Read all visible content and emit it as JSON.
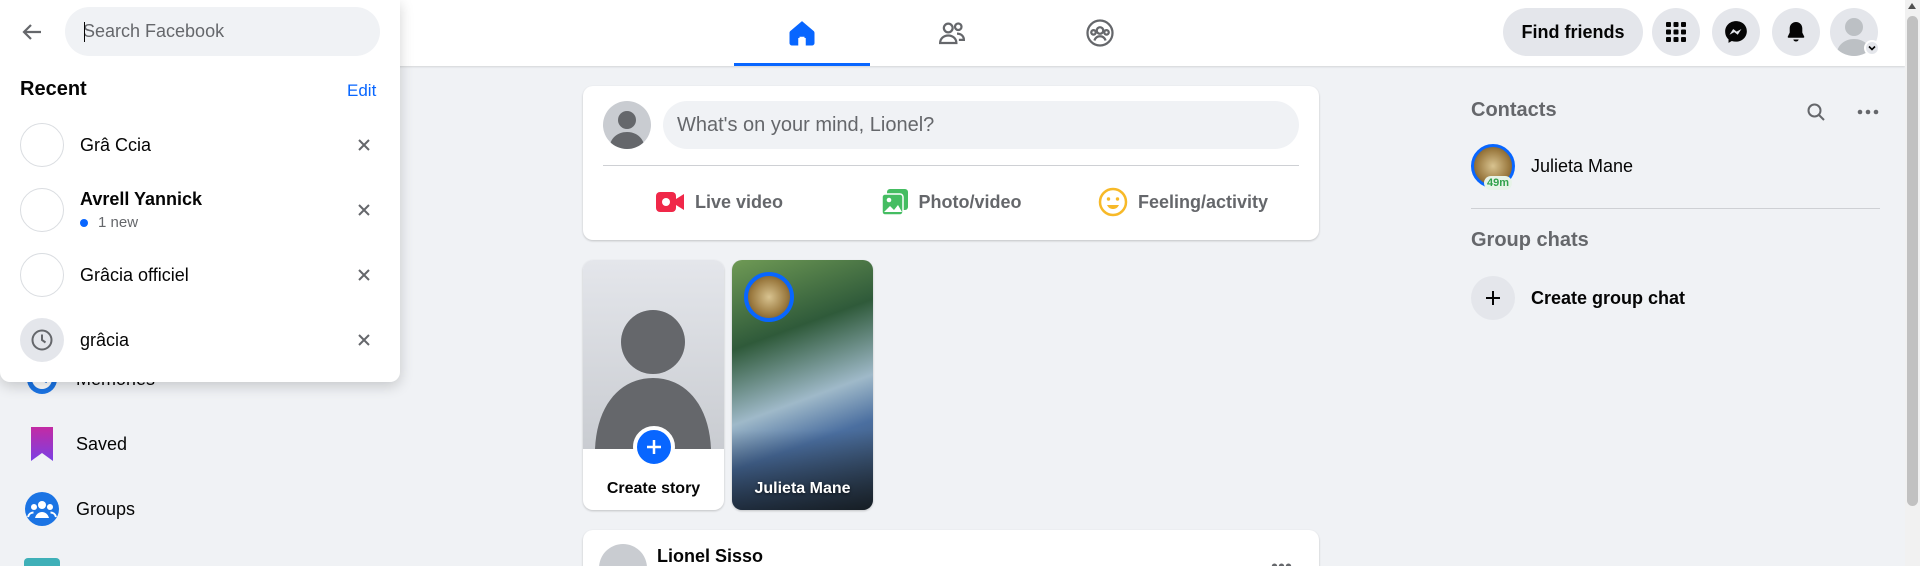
{
  "search": {
    "placeholder": "Search Facebook",
    "recent_title": "Recent",
    "edit_label": "Edit",
    "items": [
      {
        "name": "Grâ Ccia",
        "sub": "",
        "kind": "profile"
      },
      {
        "name": "Avrell Yannick",
        "sub": "1 new",
        "kind": "profile"
      },
      {
        "name": "Grâcia officiel",
        "sub": "",
        "kind": "profile"
      },
      {
        "name": "grâcia",
        "sub": "",
        "kind": "history"
      }
    ]
  },
  "header": {
    "tabs": [
      {
        "name": "home",
        "active": true,
        "icon": "home-icon"
      },
      {
        "name": "friends",
        "active": false,
        "icon": "friends-icon"
      },
      {
        "name": "groups",
        "active": false,
        "icon": "groups-icon"
      }
    ],
    "find_friends_label": "Find friends",
    "icons": [
      "menu-grid-icon",
      "messenger-icon",
      "notifications-icon",
      "account-icon"
    ]
  },
  "left_sidebar": {
    "items": [
      {
        "label": "Memories",
        "icon": "memories-icon"
      },
      {
        "label": "Saved",
        "icon": "saved-icon"
      },
      {
        "label": "Groups",
        "icon": "groups-icon"
      }
    ]
  },
  "composer": {
    "placeholder": "What's on your mind, Lionel?",
    "actions": [
      {
        "label": "Live video",
        "icon": "live-video-icon",
        "color": "#f02849"
      },
      {
        "label": "Photo/video",
        "icon": "photo-video-icon",
        "color": "#45bd62"
      },
      {
        "label": "Feeling/activity",
        "icon": "feeling-icon",
        "color": "#f7b928"
      }
    ]
  },
  "stories": {
    "create_label": "Create story",
    "items": [
      {
        "name": "Julieta Mane"
      }
    ]
  },
  "post": {
    "author": "Lionel Sisso"
  },
  "right_sidebar": {
    "contacts_title": "Contacts",
    "contacts": [
      {
        "name": "Julieta Mane",
        "badge": "49m"
      }
    ],
    "group_chats_title": "Group chats",
    "create_group_label": "Create group chat"
  },
  "colors": {
    "accent": "#0866ff",
    "background": "#f0f2f5"
  }
}
